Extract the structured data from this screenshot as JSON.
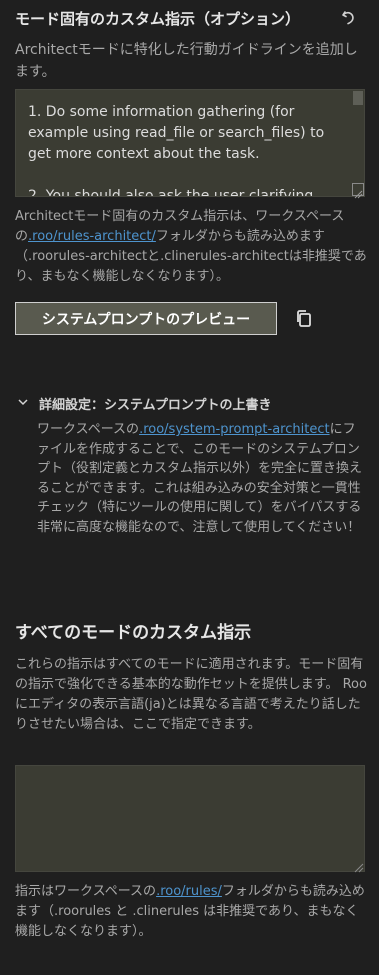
{
  "mode_section": {
    "title": "モード固有のカスタム指示（オプション）",
    "description": "Architectモードに特化した行動ガイドラインを追加します。",
    "textarea_value": "1. Do some information gathering (for example using read_file or search_files) to get more context about the task.\n\n2. You should also ask the user clarifying",
    "note_prefix": "Architectモード固有のカスタム指示は、ワークスペースの",
    "note_link": ".roo/rules-architect/",
    "note_suffix": "フォルダからも読み込めます（.roorules-architectと.clinerules-architectは非推奨であり、まもなく機能しなくなります）。"
  },
  "preview": {
    "button_label": "システムプロンプトのプレビュー"
  },
  "advanced": {
    "header": "詳細設定：システムプロンプトの上書き",
    "body_prefix": "ワークスペースの",
    "body_link": ".roo/system-prompt-architect",
    "body_suffix": "にファイルを作成することで、このモードのシステムプロンプト（役割定義とカスタム指示以外）を完全に置き換えることができます。これは組み込みの安全対策と一貫性チェック（特にツールの使用に関して）をバイパスする非常に高度な機能なので、注意して使用してください！"
  },
  "global_section": {
    "title": "すべてのモードのカスタム指示",
    "description": "これらの指示はすべてのモードに適用されます。モード固有の指示で強化できる基本的な動作セットを提供します。 Rooにエディタの表示言語(ja)とは異なる言語で考えたり話したりさせたい場合は、ここで指定できます。",
    "textarea_value": "",
    "note_prefix": "指示はワークスペースの",
    "note_link": ".roo/rules/",
    "note_suffix": "フォルダからも読み込めます（.roorules と .clinerules は非推奨であり、まもなく機能しなくなります）。"
  },
  "icons": {
    "reset": "reset-icon",
    "copy": "copy-icon",
    "chevron": "chevron-down-icon"
  },
  "colors": {
    "background": "#1f1f1f",
    "textarea_bg": "#3b3c33",
    "link": "#4e94ce",
    "button_bg": "#595a4f"
  }
}
